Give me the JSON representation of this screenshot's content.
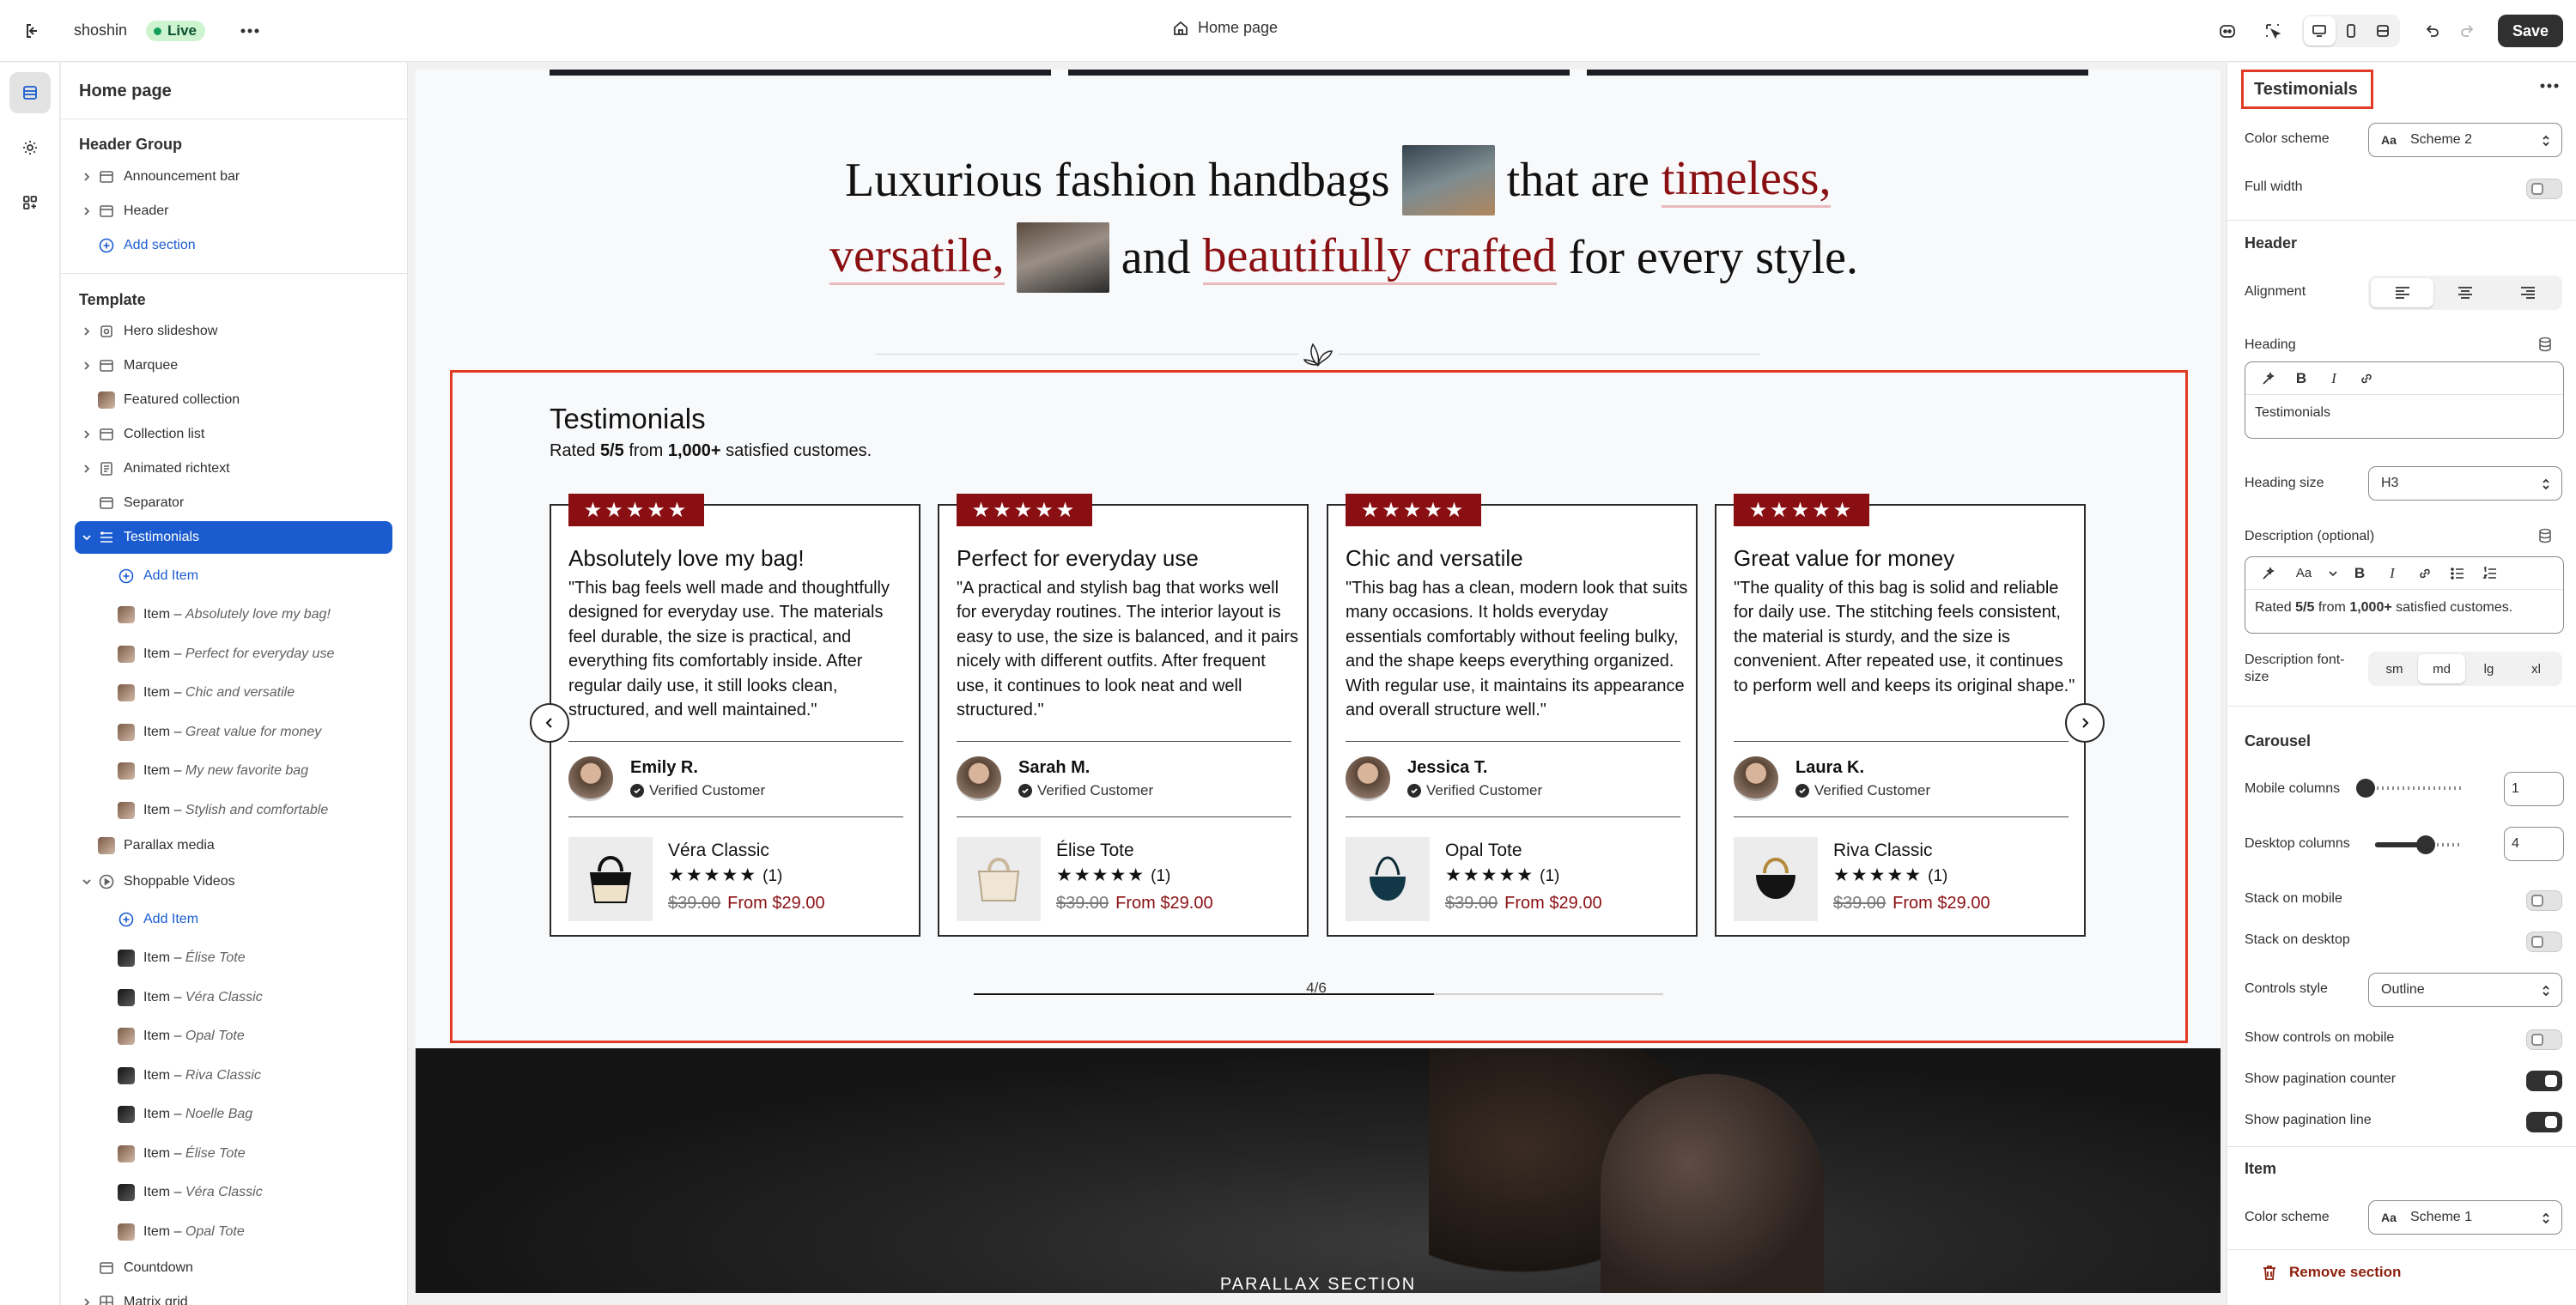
{
  "topbar": {
    "store_name": "shoshin",
    "status_badge": "Live",
    "page_name": "Home page",
    "save_label": "Save"
  },
  "sidebar": {
    "title": "Home page",
    "header_group_title": "Header Group",
    "header_items": [
      "Announcement bar",
      "Header"
    ],
    "add_section": "Add section",
    "template_title": "Template",
    "template_items": [
      "Hero slideshow",
      "Marquee",
      "Featured collection",
      "Collection list",
      "Animated richtext",
      "Separator",
      "Testimonials",
      "Add Item",
      "Item",
      "Absolutely love my bag!",
      "Perfect for everyday use",
      "Chic and versatile",
      "Great value for money",
      "My new favorite bag",
      "Stylish and comfortable",
      "Parallax media",
      "Shoppable Videos",
      "Élise Tote",
      "Véra Classic",
      "Opal Tote",
      "Riva Classic",
      "Noelle Bag",
      "Countdown",
      "Matrix grid"
    ],
    "item_dash": "Item –"
  },
  "preview": {
    "hero_line1": [
      "Luxurious fashion handbags",
      "that are",
      "timeless,"
    ],
    "hero_line2": [
      "versatile,",
      "and",
      "beautifully crafted",
      "for every style."
    ],
    "testimonials_title": "Testimonials",
    "rated_pre": "Rated",
    "rated_score": "5/5",
    "rated_mid": "from",
    "rated_count": "1,000+",
    "rated_post": "satisfied customes.",
    "stars": "★★★★★",
    "verified_label": "Verified Customer",
    "old_price": "$39.00",
    "new_price": "From $29.00",
    "review_count": "(1)",
    "cards": [
      {
        "title": "Absolutely love my bag!",
        "quote": "\"This bag feels well made and thoughtfully designed for everyday use. The materials feel durable, the size is practical, and everything fits comfortably inside. After regular daily use, it still looks clean, structured, and well maintained.\"",
        "name": "Emily R.",
        "product": "Véra Classic"
      },
      {
        "title": "Perfect for everyday use",
        "quote": "\"A practical and stylish bag that works well for everyday routines. The interior layout is easy to use, the size is balanced, and it pairs nicely with different outfits. After frequent use, it continues to look neat and well structured.\"",
        "name": "Sarah M.",
        "product": "Élise Tote"
      },
      {
        "title": "Chic and versatile",
        "quote": "\"This bag has a clean, modern look that suits many occasions. It holds everyday essentials comfortably without feeling bulky, and the shape keeps everything organized. With regular use, it maintains its appearance and overall structure well.\"",
        "name": "Jessica T.",
        "product": "Opal Tote"
      },
      {
        "title": "Great value for money",
        "quote": "\"The quality of this bag is solid and reliable for daily use. The stitching feels consistent, the material is sturdy, and the size is convenient. After repeated use, it continues to perform well and keeps its original shape.\"",
        "name": "Laura K.",
        "product": "Riva Classic"
      }
    ],
    "pagination_counter": "4/6",
    "pagination_progress": 0.667,
    "parallax_label": "PARALLAX SECTION"
  },
  "panel": {
    "title": "Testimonials",
    "color_scheme_label": "Color scheme",
    "color_scheme_value": "Scheme 2",
    "full_width_label": "Full width",
    "header_section": "Header",
    "alignment_label": "Alignment",
    "heading_label": "Heading",
    "heading_value": "Testimonials",
    "heading_size_label": "Heading size",
    "heading_size_value": "H3",
    "description_label": "Description (optional)",
    "description_pre": "Rated",
    "description_score": "5/5",
    "description_mid": "from",
    "description_count": "1,000+",
    "description_post": "satisfied customes.",
    "desc_font_label": "Description font-size",
    "font_sizes": [
      "sm",
      "md",
      "lg",
      "xl"
    ],
    "carousel_section": "Carousel",
    "mobile_columns_label": "Mobile columns",
    "mobile_columns_value": "1",
    "desktop_columns_label": "Desktop columns",
    "desktop_columns_value": "4",
    "stack_mobile_label": "Stack on mobile",
    "stack_desktop_label": "Stack on desktop",
    "controls_style_label": "Controls style",
    "controls_style_value": "Outline",
    "show_controls_mobile_label": "Show controls on mobile",
    "show_pagination_counter_label": "Show pagination counter",
    "show_pagination_line_label": "Show pagination line",
    "item_section": "Item",
    "item_color_scheme_label": "Color scheme",
    "item_color_scheme_value": "Scheme 1",
    "remove_section": "Remove section"
  }
}
